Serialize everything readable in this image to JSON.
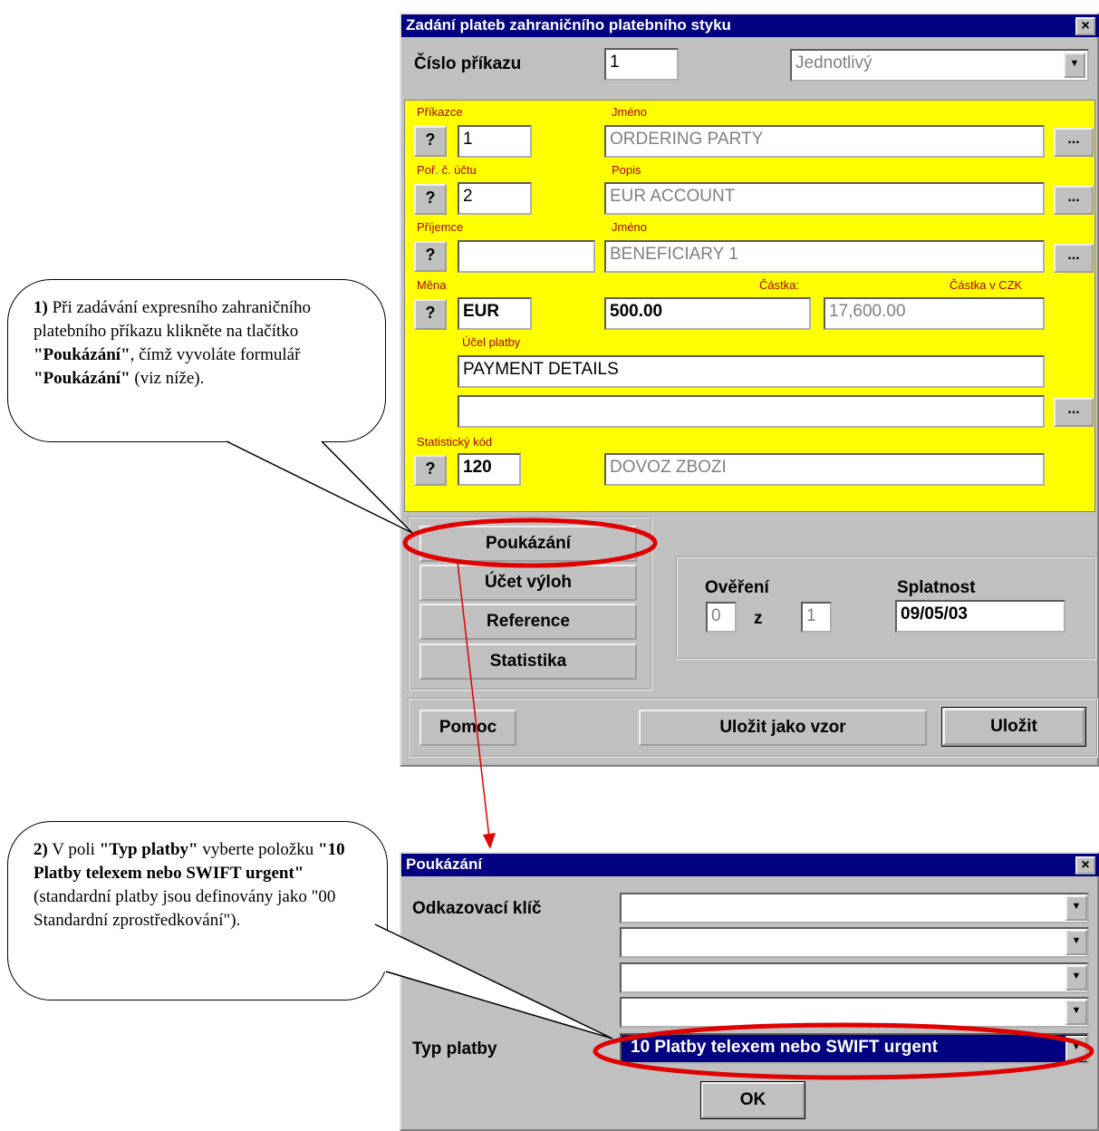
{
  "top_dialog": {
    "title": "Zadání plateb zahraničního platebního styku",
    "close": "×",
    "order_number_label": "Číslo příkazu",
    "order_number_value": "1",
    "order_type_value": "Jednotlivý",
    "orderer_label": "Příkazce",
    "orderer_name_label": "Jméno",
    "orderer_value": "1",
    "orderer_name_value": "ORDERING PARTY",
    "account_label": "Poř. č. účtu",
    "account_desc_label": "Popis",
    "account_value": "2",
    "account_desc_value": "EUR ACCOUNT",
    "beneficiary_label": "Příjemce",
    "beneficiary_name_label": "Jméno",
    "beneficiary_value": "",
    "beneficiary_name_value": "BENEFICIARY 1",
    "currency_label": "Měna",
    "amount_label": "Částka:",
    "amount_czk_label": "Částka v CZK",
    "currency_value": "EUR",
    "amount_value": "500.00",
    "amount_czk_value": "17,600.00",
    "purpose_label": "Účel platby",
    "purpose_value_1": "PAYMENT DETAILS",
    "purpose_value_2": "",
    "stat_code_label": "Statistický kód",
    "stat_code_value": "120",
    "stat_code_desc_value": "DOVOZ ZBOZI",
    "question_button": "?",
    "dots_button": "...",
    "side_buttons": [
      "Poukázání",
      "Účet výloh",
      "Reference",
      "Statistika"
    ],
    "verification_label": "Ověření",
    "verification_value_a": "0",
    "verification_of": "z",
    "verification_value_b": "1",
    "due_label": "Splatnost",
    "due_value": "09/05/03",
    "help_button": "Pomoc",
    "save_template_button": "Uložit jako vzor",
    "save_button": "Uložit"
  },
  "bottom_dialog": {
    "title": "Poukázání",
    "close": "×",
    "reference_key_label": "Odkazovací klíč",
    "reference_key_values": [
      "",
      "",
      "",
      ""
    ],
    "payment_type_label": "Typ platby",
    "payment_type_value": "10  Platby telexem nebo SWIFT urgent",
    "ok_button": "OK"
  },
  "callouts": {
    "one_num": "1)",
    "one_text": " Při zadávání expresního zahraničního platebního příkazu klikněte na tlačítko ",
    "one_b1": "\"Poukázání\"",
    "one_text2": ", čímž vyvoláte formulář ",
    "one_b2": "\"Poukázání\"",
    "one_text3": " (viz níže).",
    "two_num": "2)",
    "two_text": " V poli ",
    "two_b1": "\"Typ platby\"",
    "two_text2": " vyberte položku ",
    "two_b2": "\"10 Platby telexem nebo SWIFT urgent\"",
    "two_text3": " (standardní platby jsou definovány jako \"00 Standardní zprostředkování\")."
  },
  "colors": {
    "yellow_panel": "#ffff00",
    "title_bar": "#000080",
    "highlight": "#e00000",
    "label_red": "#b00000"
  }
}
